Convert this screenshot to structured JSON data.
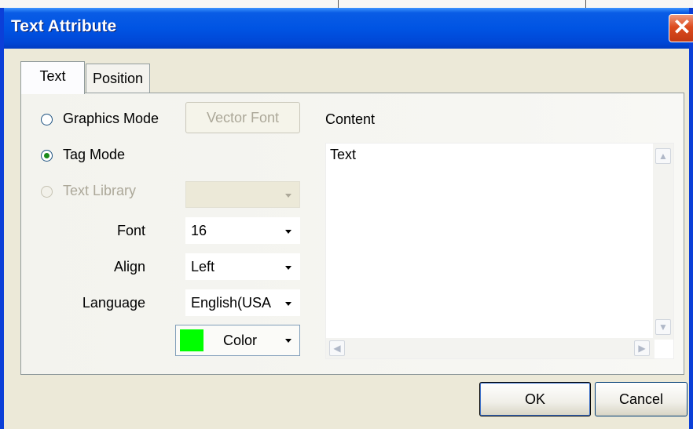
{
  "window": {
    "title": "Text Attribute",
    "close_glyph": "✕"
  },
  "tabs": [
    {
      "label": "Text",
      "active": true
    },
    {
      "label": "Position",
      "active": false
    }
  ],
  "modes": {
    "graphics_mode": {
      "label": "Graphics Mode",
      "selected": false,
      "enabled": true
    },
    "tag_mode": {
      "label": "Tag Mode",
      "selected": true,
      "enabled": true
    },
    "text_library": {
      "label": "Text Library",
      "selected": false,
      "enabled": false
    }
  },
  "vector_font_button": {
    "label": "Vector Font",
    "enabled": false
  },
  "text_library_select": {
    "value": "",
    "enabled": false
  },
  "font": {
    "label": "Font",
    "value": "16"
  },
  "align": {
    "label": "Align",
    "value": "Left"
  },
  "language": {
    "label": "Language",
    "value": "English(USA"
  },
  "color": {
    "label": "Color",
    "swatch": "#00ff00"
  },
  "content": {
    "label": "Content",
    "text": "Text"
  },
  "footer": {
    "ok_label": "OK",
    "cancel_label": "Cancel"
  },
  "colors": {
    "titlebar": "#0054e3",
    "dialog_face": "#ece9d8",
    "close_button": "#dc4b1e"
  },
  "icons": {
    "close": "close-icon",
    "dropdown": "chevron-down-icon",
    "scroll_up": "chevron-up-icon",
    "scroll_down": "chevron-down-icon",
    "scroll_left": "chevron-left-icon",
    "scroll_right": "chevron-right-icon"
  }
}
